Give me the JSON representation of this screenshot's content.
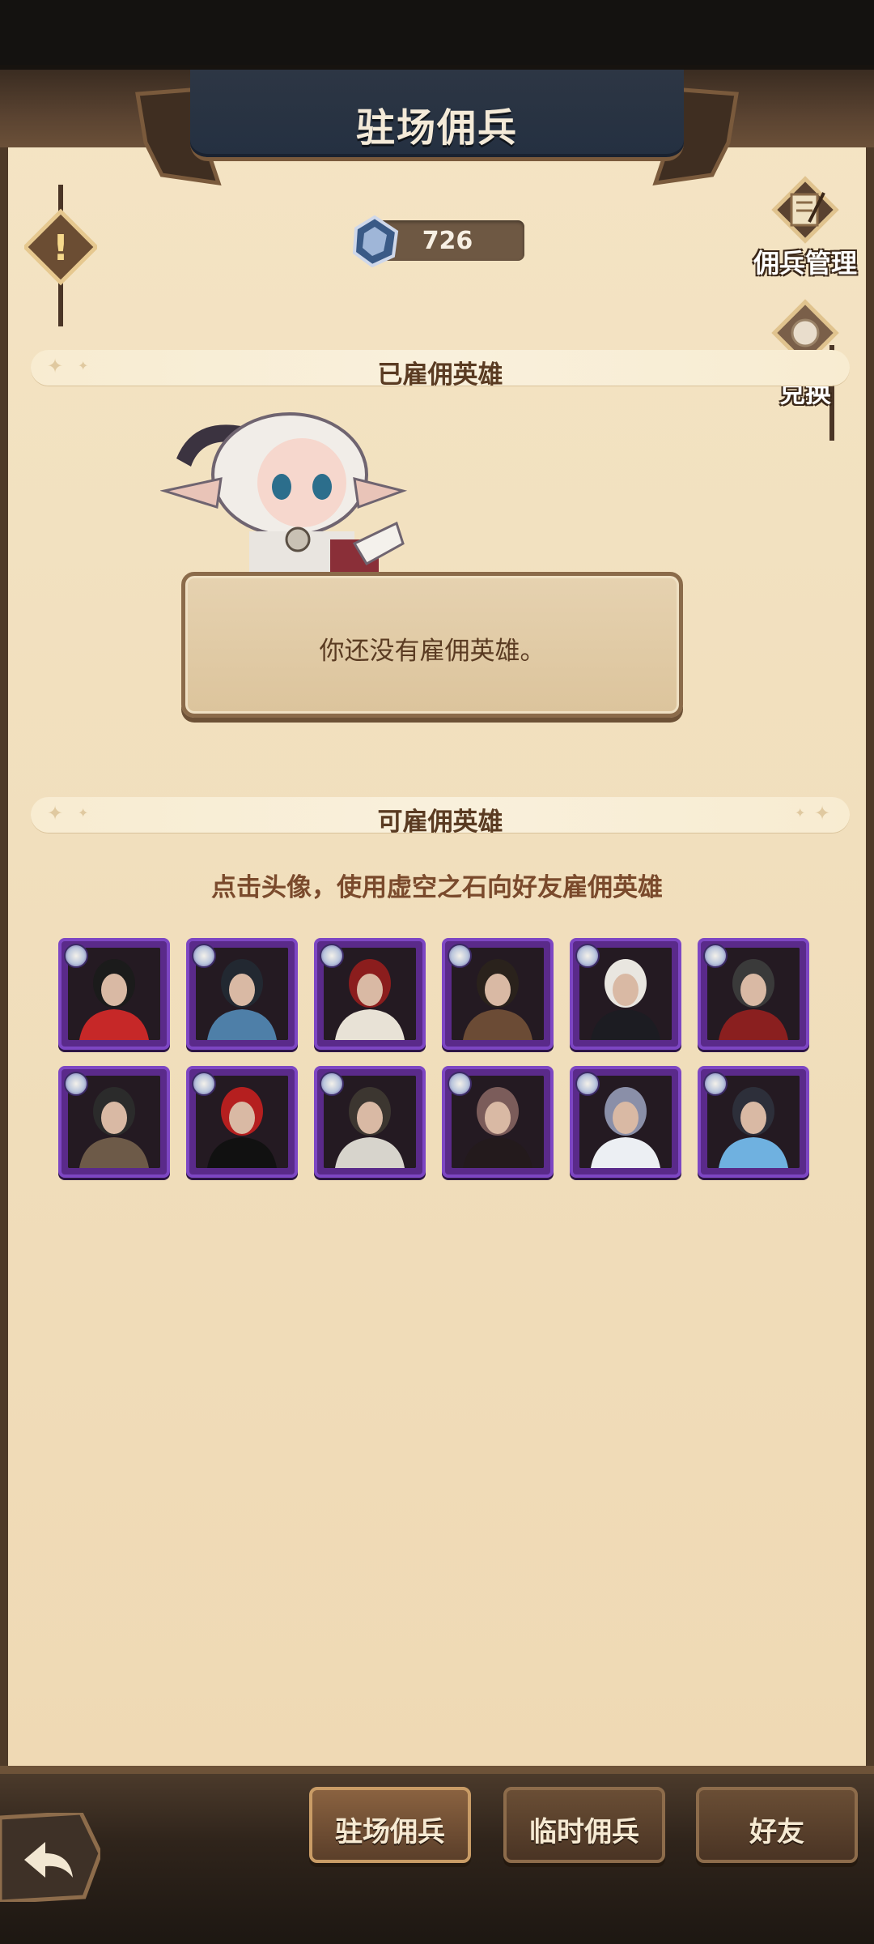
{
  "header": {
    "title": "驻场佣兵"
  },
  "currency": {
    "icon": "void-stone-icon",
    "value": "726"
  },
  "side_buttons": [
    {
      "label": "佣兵管理",
      "icon": "quill-scroll-icon"
    },
    {
      "label": "兑换",
      "icon": "exchange-orb-icon"
    }
  ],
  "hired_section": {
    "title": "已雇佣英雄",
    "empty_message": "你还没有雇佣英雄。"
  },
  "available_section": {
    "title": "可雇佣英雄",
    "hint": "点击头像，使用虚空之石向好友雇佣英雄"
  },
  "heroes": [
    {
      "row": 1,
      "col": 1,
      "colors": [
        "#c62828",
        "#1b1b1b"
      ]
    },
    {
      "row": 1,
      "col": 2,
      "colors": [
        "#4e7fa8",
        "#222831"
      ]
    },
    {
      "row": 1,
      "col": 3,
      "colors": [
        "#e8e2d6",
        "#8b1d1d"
      ]
    },
    {
      "row": 1,
      "col": 4,
      "colors": [
        "#6b4b35",
        "#2a221c"
      ]
    },
    {
      "row": 1,
      "col": 5,
      "colors": [
        "#1c1c22",
        "#e9e6e0"
      ]
    },
    {
      "row": 1,
      "col": 6,
      "colors": [
        "#8a1f1f",
        "#3a3a3a"
      ]
    },
    {
      "row": 2,
      "col": 1,
      "colors": [
        "#6d5a48",
        "#2b2b2b"
      ]
    },
    {
      "row": 2,
      "col": 2,
      "colors": [
        "#111111",
        "#b51f1f"
      ]
    },
    {
      "row": 2,
      "col": 3,
      "colors": [
        "#d7d4cc",
        "#3c3630"
      ]
    },
    {
      "row": 2,
      "col": 4,
      "colors": [
        "#231a1c",
        "#7b5c5a"
      ]
    },
    {
      "row": 2,
      "col": 5,
      "colors": [
        "#eceff3",
        "#8a8fa8"
      ]
    },
    {
      "row": 2,
      "col": 6,
      "colors": [
        "#6fb1e0",
        "#2d2f3a"
      ]
    }
  ],
  "tabs": [
    {
      "label": "驻场佣兵",
      "active": true
    },
    {
      "label": "临时佣兵",
      "active": false
    },
    {
      "label": "好友",
      "active": false
    }
  ],
  "accent_colors": {
    "hero_frame": "#7d46c3",
    "title_plate": "#2d3644",
    "parchment": "#f4e4c4"
  }
}
